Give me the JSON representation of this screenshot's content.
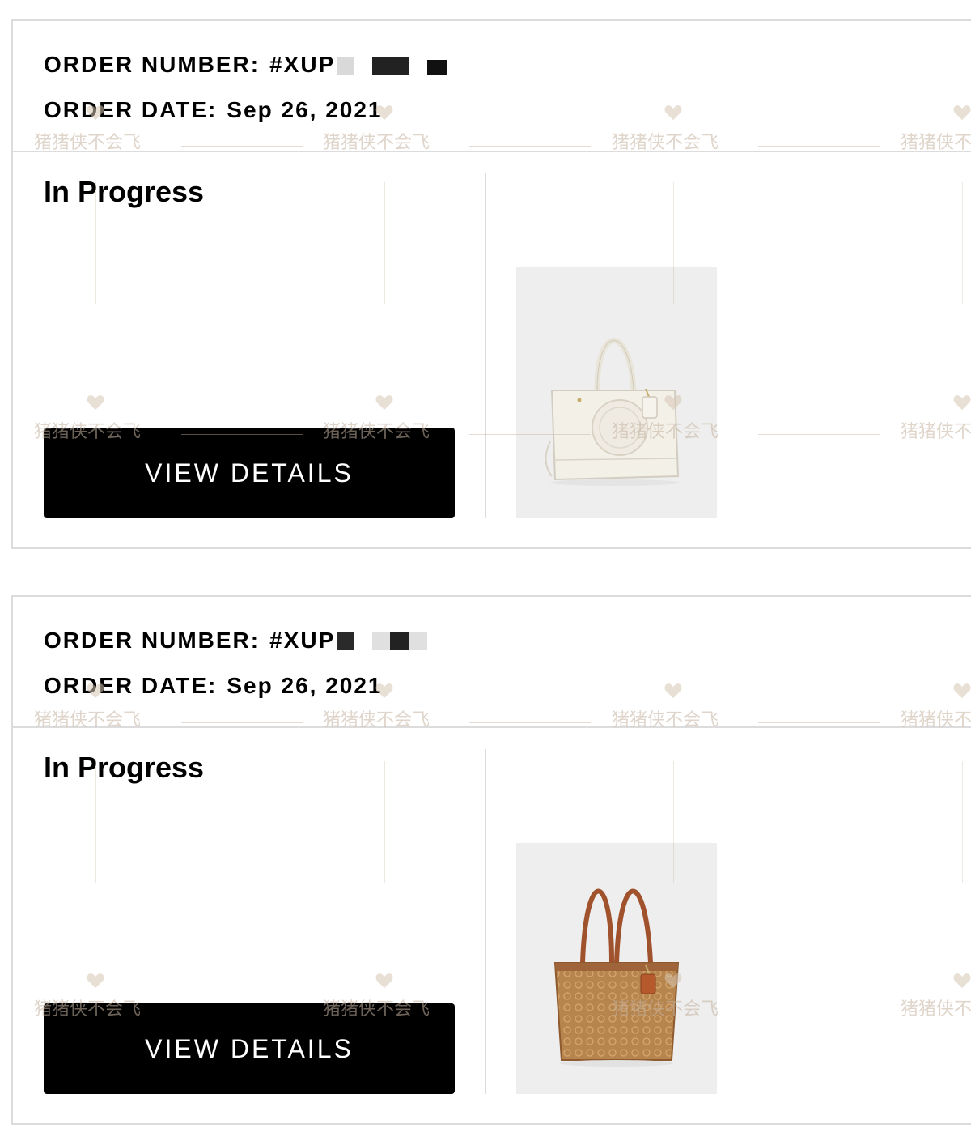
{
  "orders": [
    {
      "number_label": "ORDER NUMBER:",
      "number_value": "#XUP",
      "date_label": "ORDER DATE:",
      "date_value": "Sep 26, 2021",
      "status": "In Progress",
      "button_label": "VIEW DETAILS",
      "product": "cream-tote-bag"
    },
    {
      "number_label": "ORDER NUMBER:",
      "number_value": "#XUP",
      "date_label": "ORDER DATE:",
      "date_value": "Sep 26, 2021",
      "status": "In Progress",
      "button_label": "VIEW DETAILS",
      "product": "signature-tan-tote-bag"
    }
  ],
  "watermark": {
    "text": "猪猪侠不会飞",
    "icon": "heart-icon"
  },
  "colors": {
    "button_bg": "#000000",
    "button_text": "#ffffff",
    "border": "#dcdcdc",
    "image_bg": "#eeeeee",
    "watermark": "#c4b2a0"
  }
}
